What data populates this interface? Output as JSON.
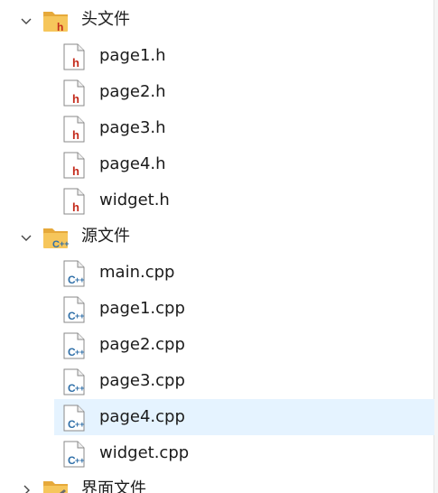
{
  "tree": {
    "groups": [
      {
        "label": "头文件",
        "expanded": true,
        "icon": "folder-h-icon",
        "files": [
          {
            "name": "page1.h",
            "icon": "header-file-icon"
          },
          {
            "name": "page2.h",
            "icon": "header-file-icon"
          },
          {
            "name": "page3.h",
            "icon": "header-file-icon"
          },
          {
            "name": "page4.h",
            "icon": "header-file-icon"
          },
          {
            "name": "widget.h",
            "icon": "header-file-icon"
          }
        ]
      },
      {
        "label": "源文件",
        "expanded": true,
        "icon": "folder-cpp-icon",
        "files": [
          {
            "name": "main.cpp",
            "icon": "cpp-file-icon"
          },
          {
            "name": "page1.cpp",
            "icon": "cpp-file-icon"
          },
          {
            "name": "page2.cpp",
            "icon": "cpp-file-icon"
          },
          {
            "name": "page3.cpp",
            "icon": "cpp-file-icon"
          },
          {
            "name": "page4.cpp",
            "icon": "cpp-file-icon",
            "selected": true
          },
          {
            "name": "widget.cpp",
            "icon": "cpp-file-icon"
          }
        ]
      },
      {
        "label": "界面文件",
        "expanded": false,
        "icon": "folder-ui-icon",
        "files": []
      }
    ],
    "colors": {
      "folder": "#f6c65b",
      "folder_back": "#e6a93a",
      "header_h": "#c42b1c",
      "cpp_blue": "#2f6fa8",
      "selection": "#e5f3ff",
      "text": "#1b1b1b"
    }
  }
}
